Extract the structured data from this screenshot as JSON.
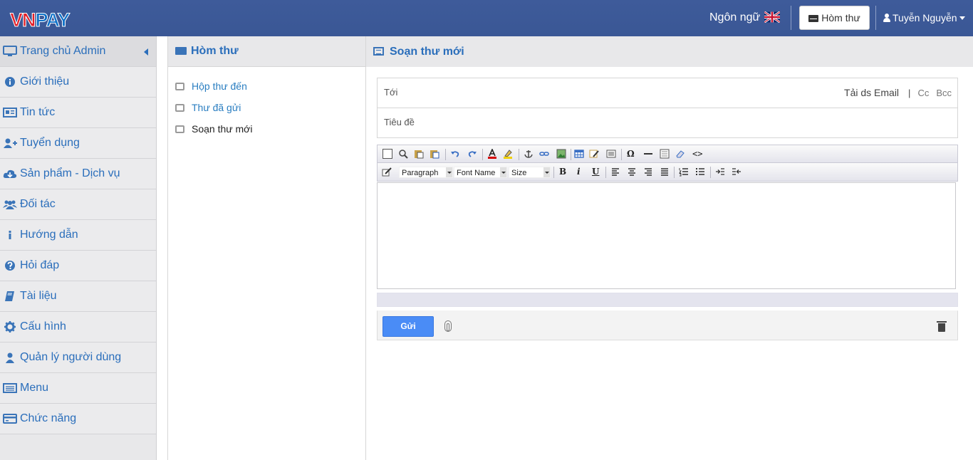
{
  "header": {
    "logo_part1": "VN",
    "logo_part2": "PAY",
    "language_label": "Ngôn ngữ",
    "mail_button": "Hòm thư",
    "user_name": "Tuyễn Nguyễn"
  },
  "sidebar": {
    "items": [
      {
        "label": "Trang chủ Admin",
        "icon": "monitor-icon"
      },
      {
        "label": "Giới thiệu",
        "icon": "info-circle-icon"
      },
      {
        "label": "Tin tức",
        "icon": "newspaper-icon"
      },
      {
        "label": "Tuyển dụng",
        "icon": "user-plus-icon"
      },
      {
        "label": "Sản phẩm - Dịch vụ",
        "icon": "cloud-download-icon"
      },
      {
        "label": "Đối tác",
        "icon": "users-icon"
      },
      {
        "label": "Hướng dẫn",
        "icon": "info-icon"
      },
      {
        "label": "Hỏi đáp",
        "icon": "question-circle-icon"
      },
      {
        "label": "Tài liệu",
        "icon": "book-icon"
      },
      {
        "label": "Cấu hình",
        "icon": "gear-icon"
      },
      {
        "label": "Quản lý người dùng",
        "icon": "user-icon"
      },
      {
        "label": "Menu",
        "icon": "list-icon"
      },
      {
        "label": "Chức năng",
        "icon": "credit-card-icon"
      }
    ]
  },
  "mailbox": {
    "title": "Hòm thư",
    "items": [
      {
        "label": "Hộp thư đến",
        "active": false
      },
      {
        "label": "Thư đã gửi",
        "active": false
      },
      {
        "label": "Soạn thư mới",
        "active": true
      }
    ]
  },
  "compose": {
    "title": "Soạn thư mới",
    "to_placeholder": "Tới",
    "load_emails": "Tải ds Email",
    "separator": "|",
    "cc": "Cc",
    "bcc": "Bcc",
    "subject_placeholder": "Tiêu đề",
    "toolbar": {
      "format_select": "Paragraph",
      "font_select": "Font Name",
      "size_select": "Size"
    },
    "send_button": "Gửi"
  },
  "colors": {
    "header_bg": "#3b5998",
    "link_blue": "#2a6ebb",
    "send_button": "#4a8cf6"
  }
}
